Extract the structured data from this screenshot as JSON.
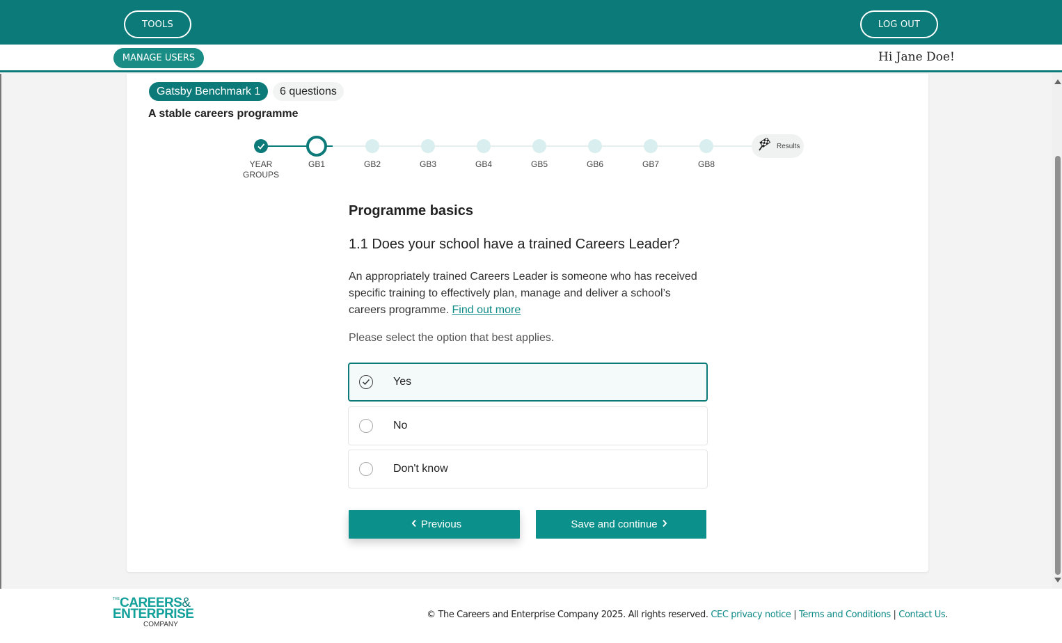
{
  "header": {
    "tools_label": "TOOLS",
    "logout_label": "LOG OUT",
    "manage_users_label": "MANAGE USERS",
    "greeting": "Hi Jane Doe!"
  },
  "benchmark": {
    "badge": "Gatsby Benchmark 1",
    "question_count": "6 questions",
    "title": "A stable careers programme"
  },
  "stepper": {
    "steps": [
      {
        "label": "YEAR\nGROUPS",
        "state": "complete"
      },
      {
        "label": "GB1",
        "state": "current"
      },
      {
        "label": "GB2",
        "state": "upcoming"
      },
      {
        "label": "GB3",
        "state": "upcoming"
      },
      {
        "label": "GB4",
        "state": "upcoming"
      },
      {
        "label": "GB5",
        "state": "upcoming"
      },
      {
        "label": "GB6",
        "state": "upcoming"
      },
      {
        "label": "GB7",
        "state": "upcoming"
      },
      {
        "label": "GB8",
        "state": "upcoming"
      }
    ],
    "results_label": "Results",
    "results_icon": "finish-flag-icon"
  },
  "question": {
    "section_heading": "Programme basics",
    "title": "1.1 Does your school have a trained Careers Leader?",
    "description": "An appropriately trained Careers Leader is someone who has received specific training to effectively plan, manage and deliver a school’s careers programme.",
    "find_out_more": "Find out more",
    "instruction": "Please select the option that best applies.",
    "options": [
      {
        "label": "Yes",
        "selected": true
      },
      {
        "label": "No",
        "selected": false
      },
      {
        "label": "Don't know",
        "selected": false
      }
    ]
  },
  "actions": {
    "previous_label": "Previous",
    "next_label": "Save and continue"
  },
  "footer": {
    "logo": {
      "the": "THE",
      "line1": "CAREERS",
      "amp": "&",
      "line2": "ENTERPRISE",
      "line3": "COMPANY"
    },
    "copyright": "© The Careers and Enterprise Company 2025. All rights reserved.",
    "privacy_link": "CEC privacy notice",
    "terms_link": "Terms and Conditions",
    "contact_link": "Contact Us",
    "separator": "|",
    "period": "."
  },
  "colors": {
    "brand_teal": "#0c7a78",
    "button_teal": "#0c908c",
    "link_teal": "#0c8a86",
    "step_upcoming": "#d9eeee"
  }
}
